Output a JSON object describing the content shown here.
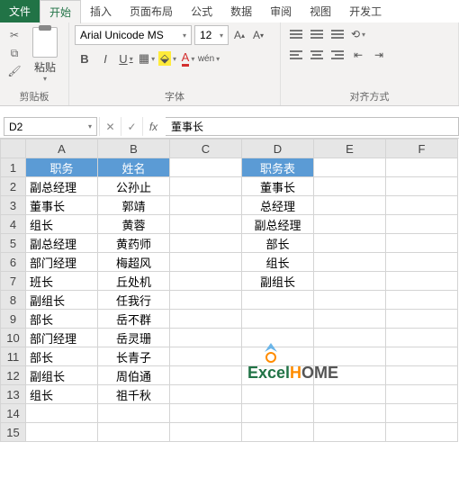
{
  "tabs": {
    "file": "文件",
    "home": "开始",
    "insert": "插入",
    "layout": "页面布局",
    "formulas": "公式",
    "data": "数据",
    "review": "审阅",
    "view": "视图",
    "dev": "开发工"
  },
  "ribbon": {
    "clipboard": {
      "paste": "粘贴",
      "label": "剪贴板"
    },
    "font": {
      "name": "Arial Unicode MS",
      "size": "12",
      "bold": "B",
      "italic": "I",
      "underline": "U",
      "wen": "wén",
      "label": "字体"
    },
    "align": {
      "label": "对齐方式"
    }
  },
  "namebox": "D2",
  "formula": "董事长",
  "cols": [
    "A",
    "B",
    "C",
    "D",
    "E",
    "F"
  ],
  "rows": [
    "1",
    "2",
    "3",
    "4",
    "5",
    "6",
    "7",
    "8",
    "9",
    "10",
    "11",
    "12",
    "13",
    "14",
    "15"
  ],
  "header": {
    "a": "职务",
    "b": "姓名",
    "d": "职务表"
  },
  "tableAB": [
    [
      "副总经理",
      "公孙止"
    ],
    [
      "董事长",
      "郭靖"
    ],
    [
      "组长",
      "黄蓉"
    ],
    [
      "副总经理",
      "黄药师"
    ],
    [
      "部门经理",
      "梅超风"
    ],
    [
      "班长",
      "丘处机"
    ],
    [
      "副组长",
      "任我行"
    ],
    [
      "部长",
      "岳不群"
    ],
    [
      "部门经理",
      "岳灵珊"
    ],
    [
      "部长",
      "长青子"
    ],
    [
      "副组长",
      "周伯通"
    ],
    [
      "组长",
      "祖千秋"
    ]
  ],
  "tableD": [
    "董事长",
    "总经理",
    "副总经理",
    "部长",
    "组长",
    "副组长"
  ],
  "logo": {
    "ex": "Excel",
    "h": "H",
    "rest": "OME"
  }
}
